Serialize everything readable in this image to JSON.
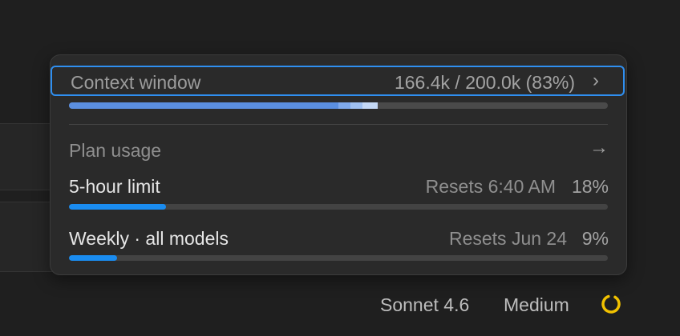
{
  "popover": {
    "context_window": {
      "label": "Context window",
      "value": "166.4k / 200.0k (83%)",
      "chevron": "›",
      "used_fraction": 0.83,
      "segments": [
        {
          "fraction": 0.5,
          "color": "#5b8fe0"
        },
        {
          "fraction": 0.022,
          "color": "#7fa9ea"
        },
        {
          "fraction": 0.022,
          "color": "#9fc0f0"
        },
        {
          "fraction": 0.029,
          "color": "#c4d8f5"
        }
      ]
    },
    "plan_usage": {
      "label": "Plan usage",
      "arrow": "→"
    },
    "limits": [
      {
        "title": "5-hour limit",
        "reset": "Resets 6:40 AM",
        "percent_text": "18%",
        "fraction": 0.18
      },
      {
        "title": "Weekly · all models",
        "reset": "Resets Jun 24",
        "percent_text": "9%",
        "fraction": 0.09
      }
    ]
  },
  "status_bar": {
    "model": "Sonnet 4.6",
    "effort": "Medium",
    "loader_icon": "spinner-ring-icon",
    "loader_color": "#f2c200"
  },
  "colors": {
    "accent": "#2f8ff0",
    "limit_fill": "#1a8cf0"
  }
}
